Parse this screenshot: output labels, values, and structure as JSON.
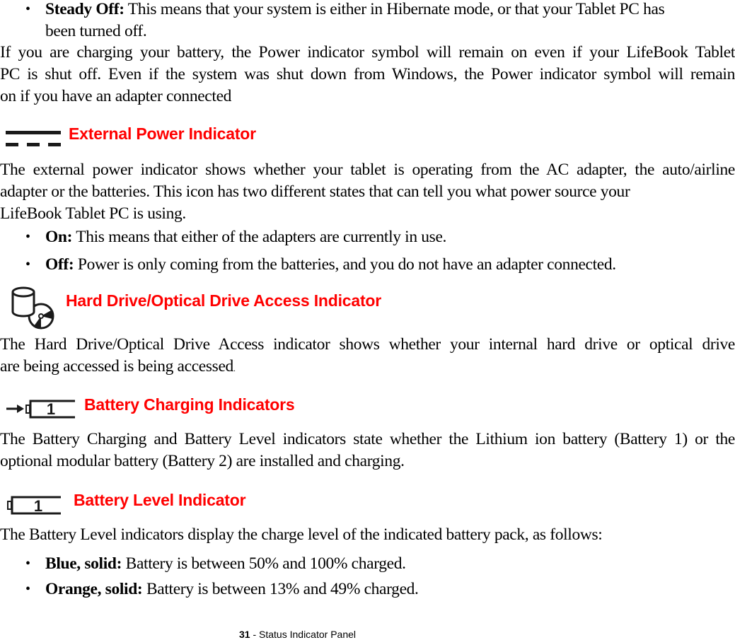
{
  "top_bullet": {
    "label": "Steady Off:",
    "text": " This means that your system is either in Hibernate mode, or that your Tablet PC has",
    "text_line2": "been turned off."
  },
  "intro_paragraph": {
    "line1": "If you are charging your battery, the Power indicator symbol will remain on even if your LifeBook Tablet",
    "line2": "PC is shut off. Even if the system was shut down from Windows, the Power indicator symbol will remain",
    "line3": "on if you have an adapter connected"
  },
  "sections": [
    {
      "icon": "dc-power-icon",
      "heading": "External Power Indicator",
      "paragraph": {
        "line1": "The external power indicator shows whether your tablet is operating from the AC adapter, the auto/airline",
        "line2": "adapter or the batteries. This icon has two different states that can tell you what power source your",
        "line3": "LifeBook Tablet PC is using."
      },
      "bullets": [
        {
          "label": "On:",
          "text": " This means that either of the adapters are currently in use."
        },
        {
          "label": "Off:",
          "text": " Power is only coming from the batteries, and you do not have an adapter connected."
        }
      ]
    },
    {
      "icon": "drive-icon",
      "heading": "Hard Drive/Optical Drive Access Indicator",
      "paragraph": {
        "line1": "The Hard Drive/Optical Drive Access indicator shows whether your internal hard drive or optical drive",
        "line2": "are being accessed is being accessed",
        "trailing": "."
      }
    },
    {
      "icon": "battery-charging-icon",
      "icon_label": "1",
      "heading": "Battery Charging Indicators",
      "paragraph": {
        "line1": "The Battery Charging and Battery Level indicators state whether the Lithium ion battery (Battery 1) or the",
        "line2": "optional modular battery (Battery 2) are installed and charging."
      }
    },
    {
      "icon": "battery-level-icon",
      "icon_label": "1",
      "heading": "Battery Level Indicator",
      "paragraph": {
        "line1": "The Battery Level indicators display the charge level of the indicated battery pack, as follows:"
      },
      "bullets": [
        {
          "label": "Blue, solid:",
          "text": " Battery is between 50% and 100% charged."
        },
        {
          "label": "Orange, solid:",
          "text": " Battery is between 13% and 49% charged."
        }
      ]
    }
  ],
  "footer": {
    "page_number": "31",
    "separator": " - ",
    "section_title": "Status Indicator Panel"
  },
  "colors": {
    "heading": "#ff0000",
    "text": "#000000"
  },
  "bullet_glyph": "•"
}
